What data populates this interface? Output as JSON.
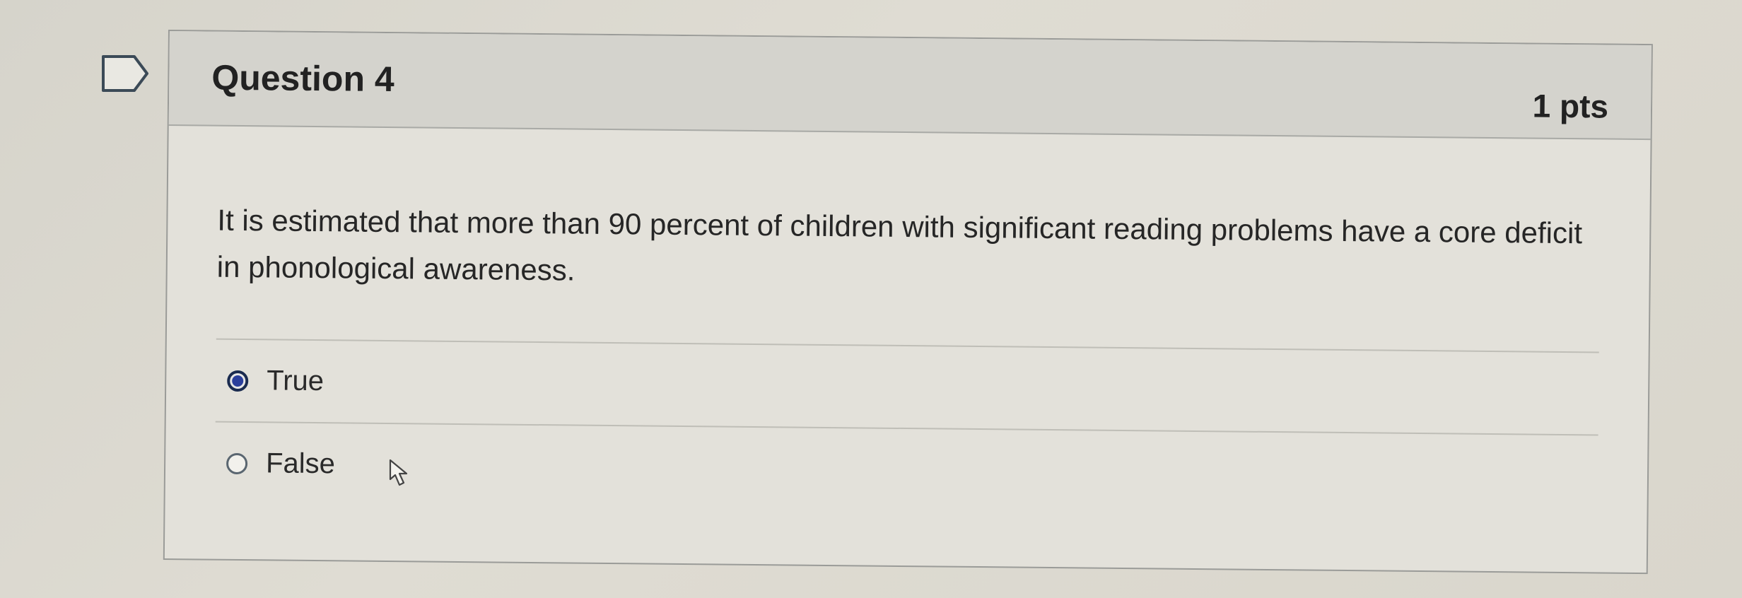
{
  "question": {
    "title": "Question 4",
    "points": "1 pts",
    "text": "It is estimated that more than 90 percent of children with significant reading problems have a core deficit in phonological awareness.",
    "answers": [
      {
        "label": "True",
        "selected": true
      },
      {
        "label": "False",
        "selected": false
      }
    ]
  },
  "icons": {
    "flag": "flag-icon",
    "cursor": "mouse-pointer-icon"
  },
  "colors": {
    "radio_selected": "#2b3f9c",
    "header_bg": "#d4d3cd"
  }
}
